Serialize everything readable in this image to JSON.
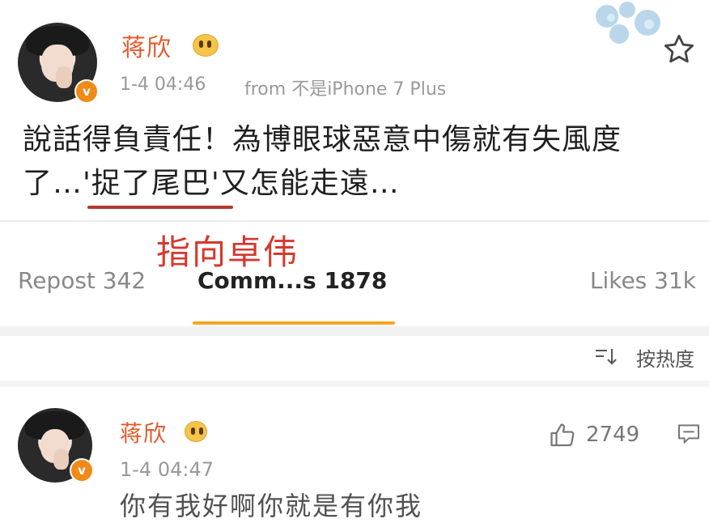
{
  "post": {
    "username": "蒋欣",
    "timestamp": "1-4 04:46",
    "source": "from 不是iPhone 7 Plus",
    "badge": "v",
    "content_line1": "說話得負責任！為博眼球惡意中傷就有失風度",
    "content_line2": "了…'捉了尾巴'又怎能走遠…",
    "annotation": "指向卓伟",
    "underline_color": "#b3382f",
    "annotation_color": "#d6382c"
  },
  "stats": {
    "repost": "Repost 342",
    "comments": "Comm...s 1878",
    "likes": "Likes 31k",
    "active_color": "#f5a623"
  },
  "sort": {
    "label": "按热度"
  },
  "comment": {
    "username": "蒋欣",
    "timestamp": "1-4 04:47",
    "like_count": "2749",
    "text_partial": "你有我好啊你就是有你我"
  },
  "colors": {
    "username": "#e35b2c",
    "badge": "#f08a18"
  }
}
